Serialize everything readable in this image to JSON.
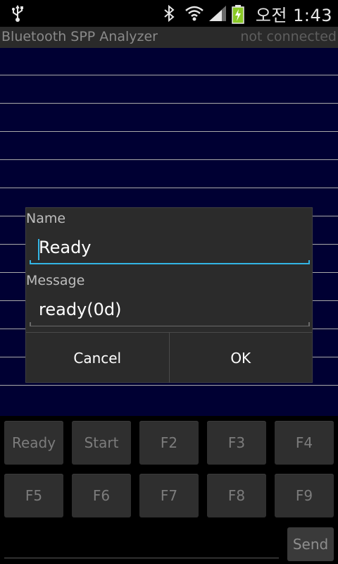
{
  "status_bar": {
    "time": "오전 1:43",
    "icons": [
      "usb-icon",
      "bluetooth-icon",
      "wifi-icon",
      "signal-icon",
      "battery-charging-icon"
    ]
  },
  "app": {
    "title": "Bluetooth SPP Analyzer",
    "connection_status": "not connected"
  },
  "dialog": {
    "name_label": "Name",
    "name_value": "Ready",
    "message_label": "Message",
    "message_value": "ready(0d)",
    "cancel_label": "Cancel",
    "ok_label": "OK"
  },
  "function_keys": {
    "row1": [
      "Ready",
      "Start",
      "F2",
      "F3",
      "F4"
    ],
    "row2": [
      "F5",
      "F6",
      "F7",
      "F8",
      "F9"
    ]
  },
  "send_label": "Send",
  "colors": {
    "log_background": "#000033",
    "focus_accent": "#33b5e5"
  }
}
